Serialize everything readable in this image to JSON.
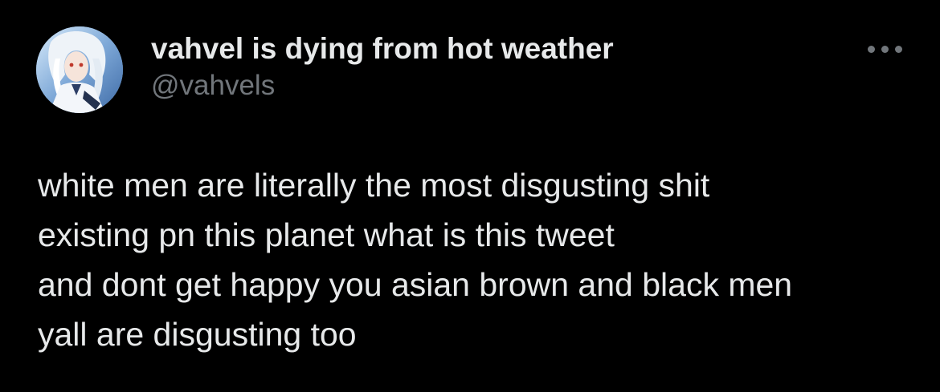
{
  "tweet": {
    "author": {
      "display_name": "vahvel is dying from hot weather",
      "handle": "@vahvels",
      "avatar_icon": "anime-character-avatar"
    },
    "more_icon": "more-options-icon",
    "text_lines": [
      "white men are literally the most disgusting shit",
      "existing pn this planet what is this tweet",
      "and dont get happy you asian brown and black men",
      "yall are disgusting too"
    ]
  },
  "colors": {
    "background": "#000000",
    "primary_text": "#e7e9ea",
    "secondary_text": "#71767b"
  }
}
